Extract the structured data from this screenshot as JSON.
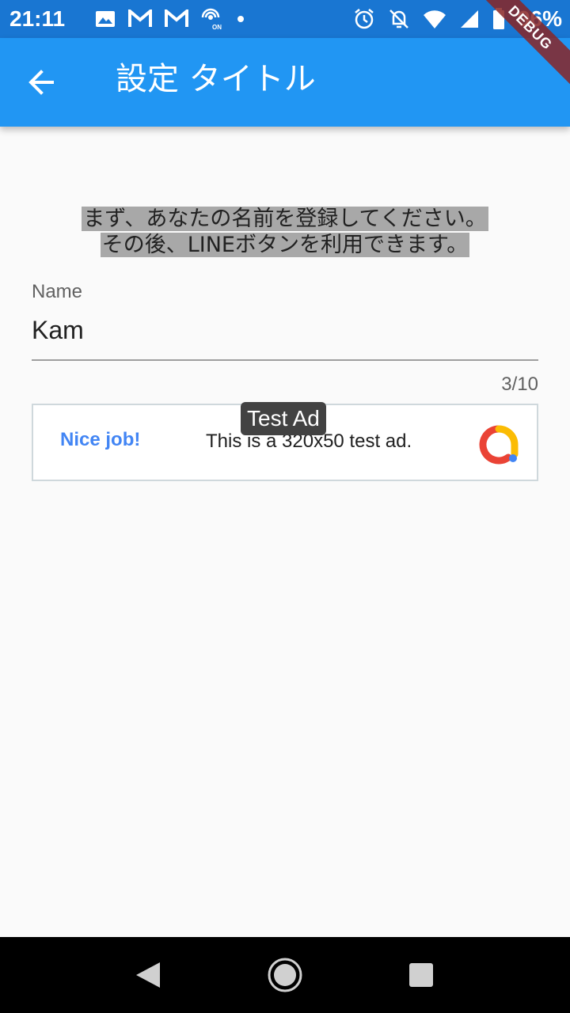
{
  "status_bar": {
    "time": "21:11",
    "battery_percent": "96%",
    "icons_left": [
      "image-icon",
      "gmail-icon",
      "gmail-icon",
      "hotspot-icon",
      "dot-icon"
    ],
    "icons_right": [
      "alarm-icon",
      "bell-off-icon",
      "wifi-icon",
      "signal-icon",
      "battery-icon"
    ]
  },
  "app_bar": {
    "title": "設定 タイトル",
    "back_icon": "arrow-back-icon",
    "debug_badge": "DEBUG"
  },
  "intro": {
    "line1": "まず、あなたの名前を登録してください。",
    "line2": "その後、LINEボタンを利用できます。"
  },
  "name_field": {
    "label": "Name",
    "value": "Kam",
    "counter": "3/10"
  },
  "ad": {
    "badge": "Test Ad",
    "headline": "Nice job!",
    "text": "This is a 320x50 test ad."
  },
  "nav_bar": {
    "back": "nav-back-icon",
    "home": "nav-home-icon",
    "recents": "nav-recents-icon"
  },
  "colors": {
    "status_bar": "#1976d2",
    "app_bar": "#2196f3",
    "background": "#fafafa",
    "ad_headline": "#4285f4"
  }
}
